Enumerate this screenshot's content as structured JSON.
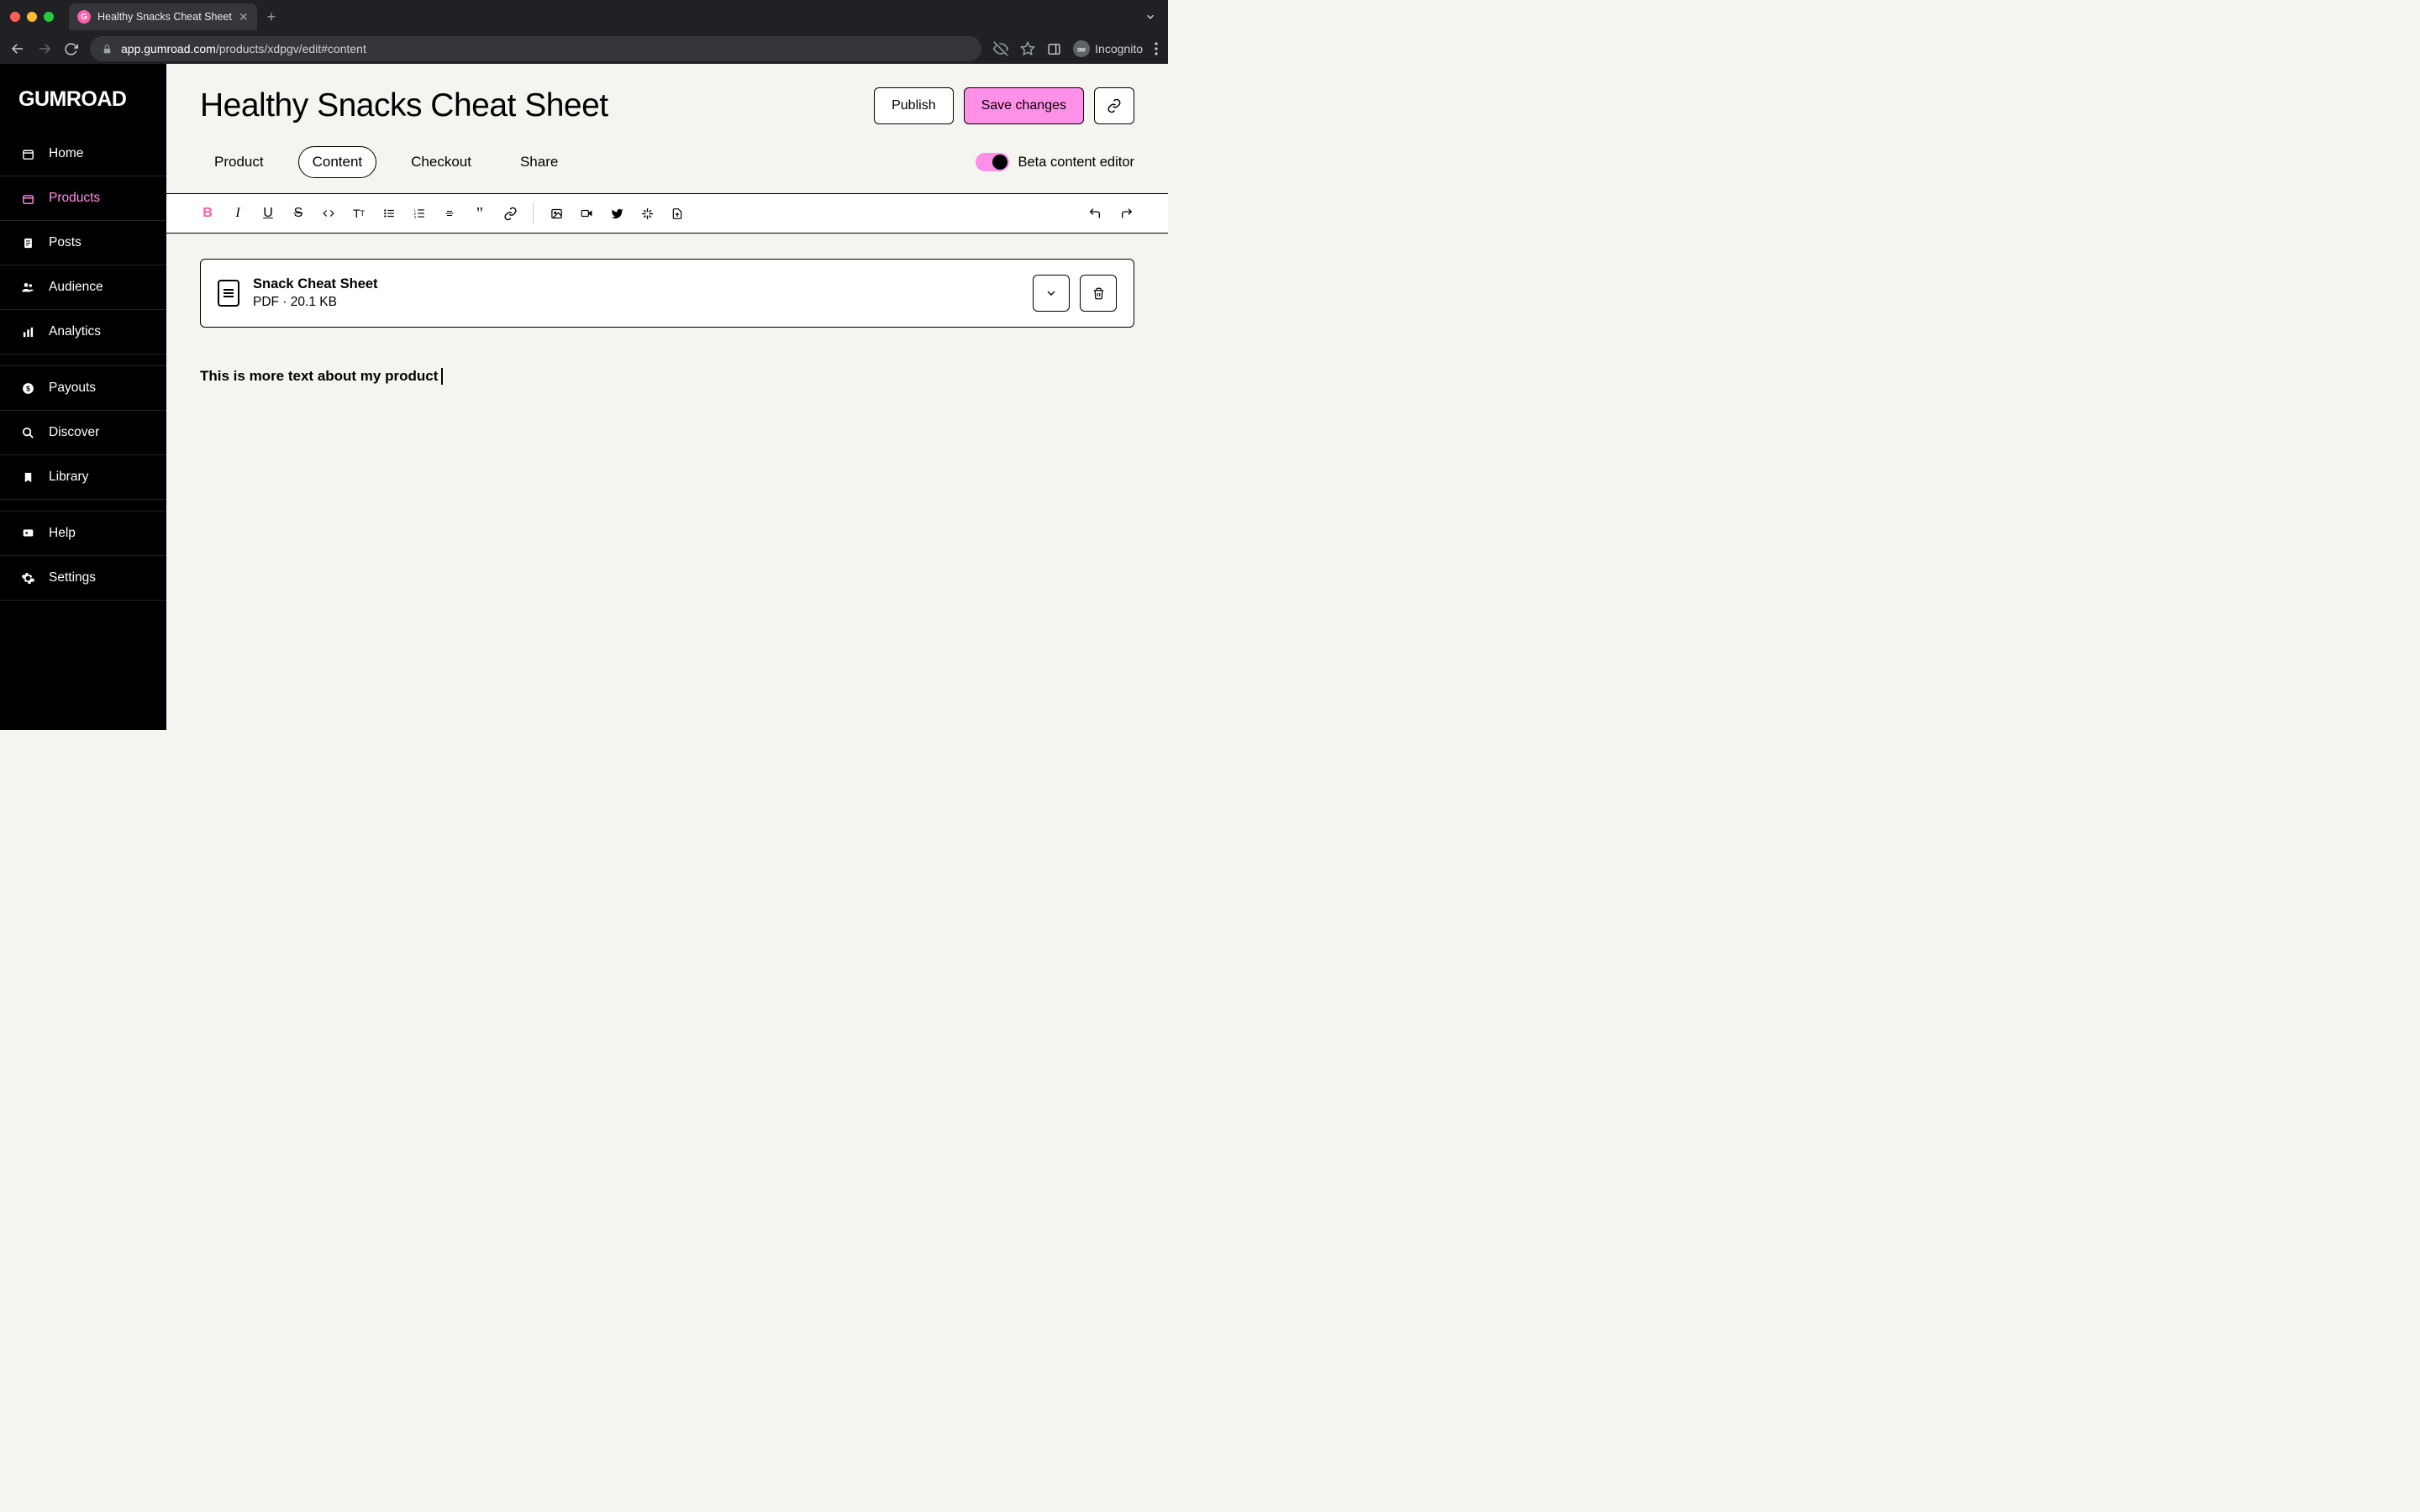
{
  "browser": {
    "tab_title": "Healthy Snacks Cheat Sheet",
    "url_host": "app.gumroad.com",
    "url_path": "/products/xdpgv/edit#content",
    "incognito_label": "Incognito"
  },
  "sidebar": {
    "logo": "GUMROAD",
    "items": [
      {
        "label": "Home",
        "icon": "home"
      },
      {
        "label": "Products",
        "icon": "products",
        "active": true
      },
      {
        "label": "Posts",
        "icon": "posts"
      },
      {
        "label": "Audience",
        "icon": "audience"
      },
      {
        "label": "Analytics",
        "icon": "analytics"
      }
    ],
    "secondary": [
      {
        "label": "Payouts",
        "icon": "payouts"
      },
      {
        "label": "Discover",
        "icon": "discover"
      },
      {
        "label": "Library",
        "icon": "library"
      }
    ],
    "footer": [
      {
        "label": "Help",
        "icon": "help"
      },
      {
        "label": "Settings",
        "icon": "settings"
      }
    ]
  },
  "header": {
    "title": "Healthy Snacks Cheat Sheet",
    "publish_label": "Publish",
    "save_label": "Save changes",
    "beta_label": "Beta content editor"
  },
  "tabs": {
    "product": "Product",
    "content": "Content",
    "checkout": "Checkout",
    "share": "Share"
  },
  "file": {
    "name": "Snack Cheat Sheet",
    "type": "PDF",
    "size": "20.1 KB"
  },
  "editor": {
    "body_text": "This is more text about my product"
  },
  "colors": {
    "accent": "#ff90e8"
  }
}
